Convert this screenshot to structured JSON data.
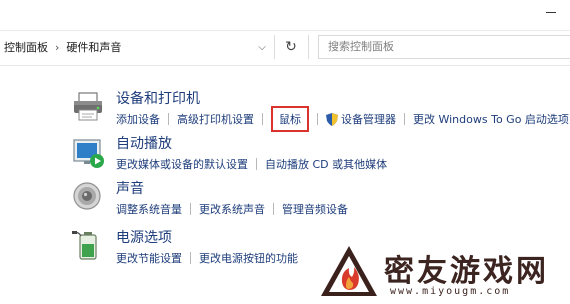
{
  "breadcrumb": [
    "控制面板",
    "硬件和声音"
  ],
  "search": {
    "placeholder": "搜索控制面板"
  },
  "categories": [
    {
      "title": "设备和打印机",
      "icon": "printer-icon",
      "links": [
        "添加设备",
        "高级打印机设置",
        "鼠标",
        "设备管理器",
        "更改 Windows To Go 启动选项"
      ]
    },
    {
      "title": "自动播放",
      "icon": "autoplay-icon",
      "links": [
        "更改媒体或设备的默认设置",
        "自动播放 CD 或其他媒体"
      ]
    },
    {
      "title": "声音",
      "icon": "speaker-icon",
      "links": [
        "调整系统音量",
        "更改系统声音",
        "管理音频设备"
      ]
    },
    {
      "title": "电源选项",
      "icon": "battery-icon",
      "links": [
        "更改节能设置",
        "更改电源按钮的功能"
      ]
    }
  ],
  "watermark": {
    "text": "密友游戏网",
    "url": "www.miyougm.com"
  },
  "colors": {
    "link": "#1e3d7b",
    "highlight": "#d9332b"
  }
}
